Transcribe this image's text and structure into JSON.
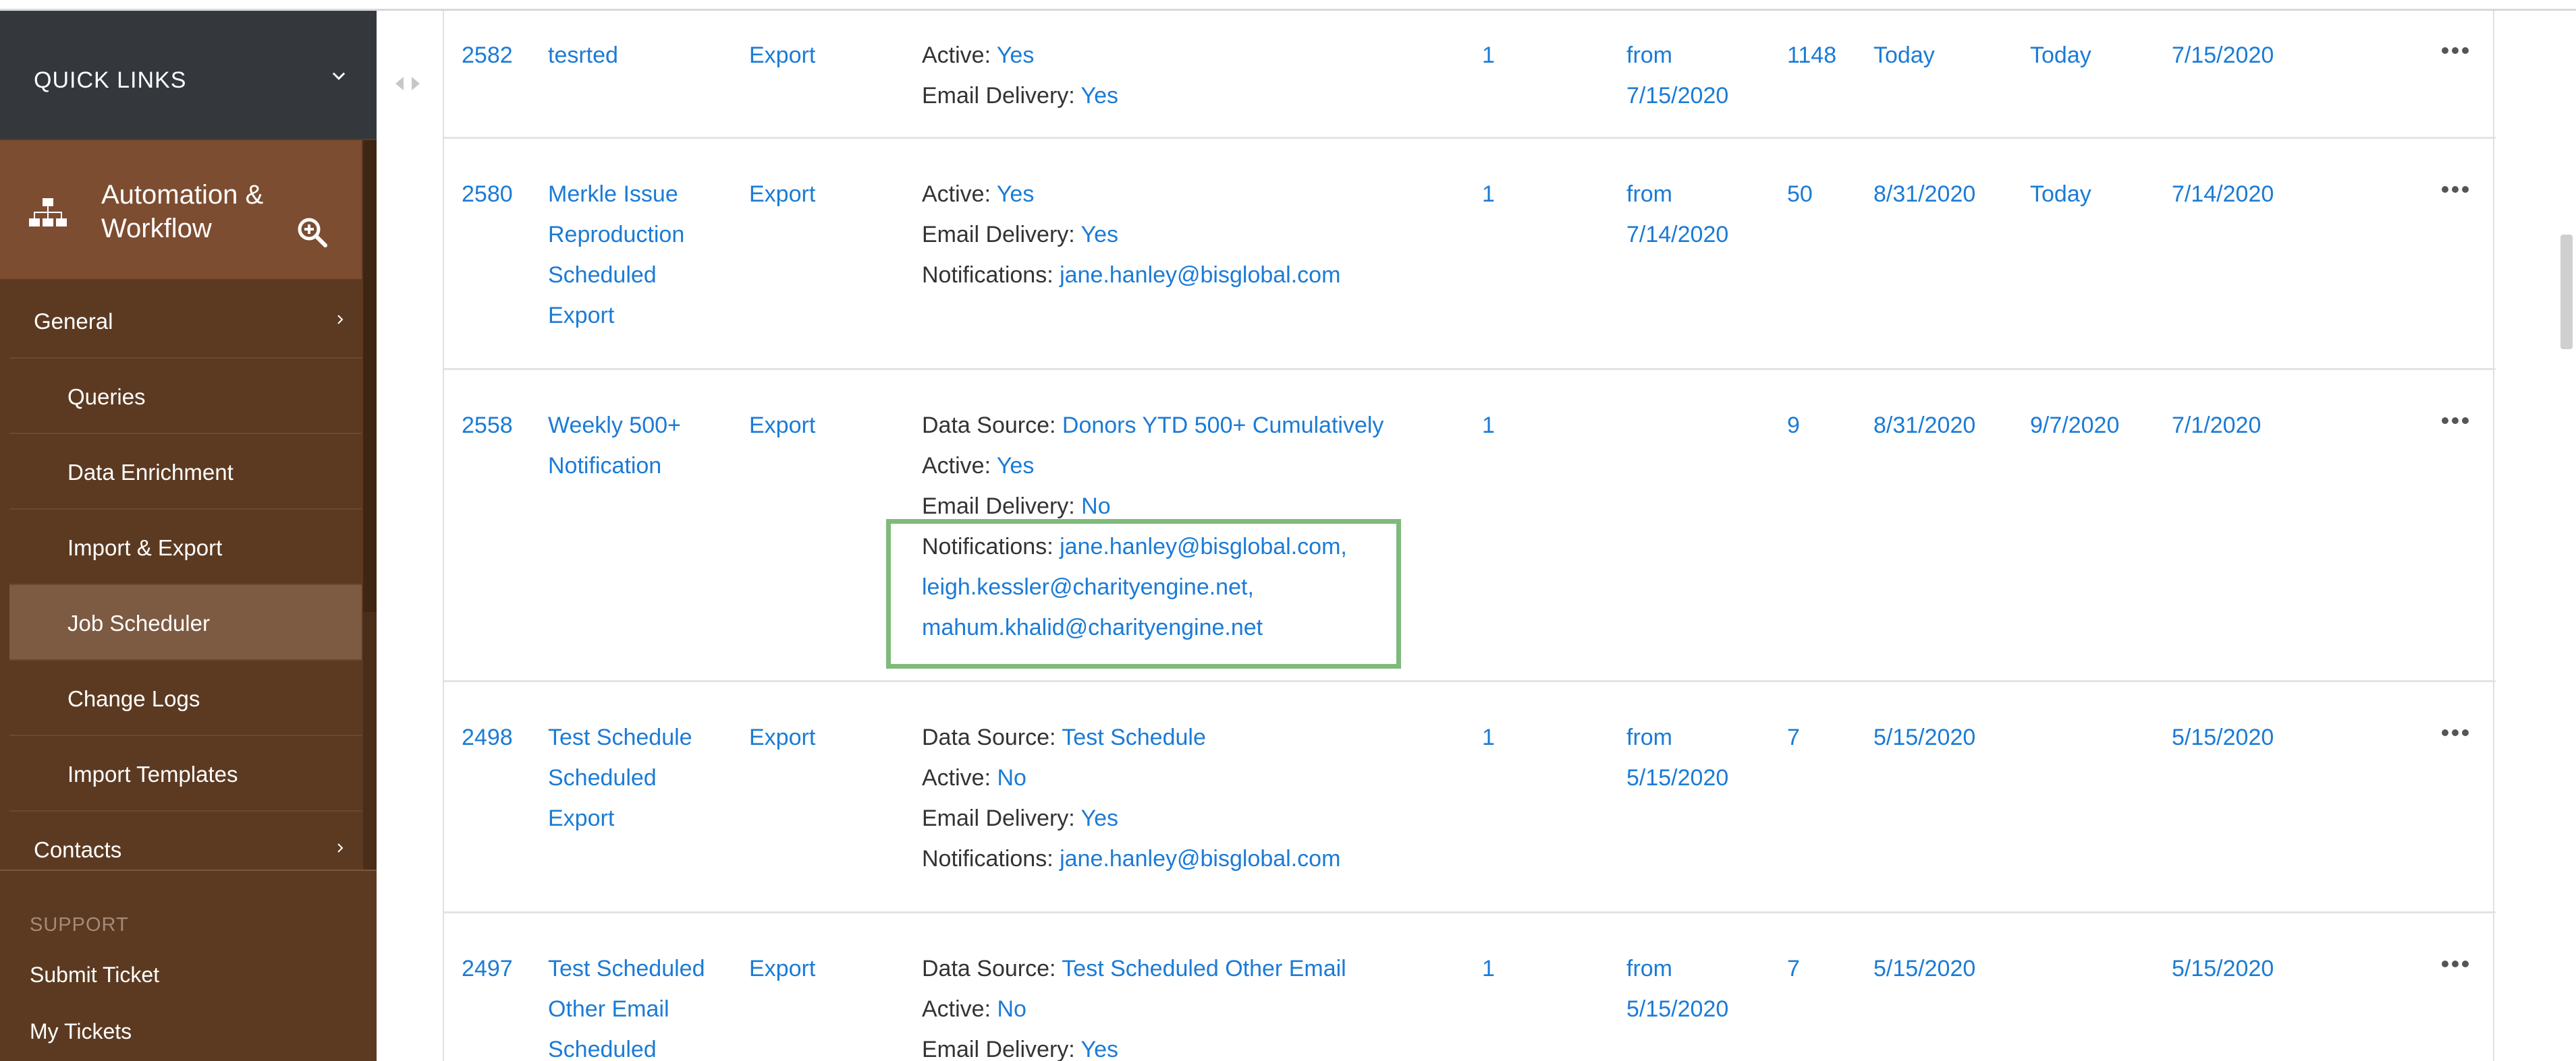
{
  "sidebar": {
    "quick_links_label": "QUICK LINKS",
    "module_title": "Automation & Workflow",
    "nav": [
      {
        "label": "General",
        "kind": "group",
        "has_chevron": true
      },
      {
        "label": "Queries",
        "kind": "sub"
      },
      {
        "label": "Data Enrichment",
        "kind": "sub"
      },
      {
        "label": "Import & Export",
        "kind": "sub"
      },
      {
        "label": "Job Scheduler",
        "kind": "sub",
        "active": true
      },
      {
        "label": "Change Logs",
        "kind": "sub"
      },
      {
        "label": "Import Templates",
        "kind": "sub"
      },
      {
        "label": "Contacts",
        "kind": "group",
        "has_chevron": true
      }
    ],
    "support_heading": "SUPPORT",
    "support_links": [
      "Submit Ticket",
      "My Tickets"
    ]
  },
  "icons": {
    "quick_links_chevron": "chevron-down-icon",
    "module_icon": "sitemap-icon",
    "module_search": "zoom-in-icon",
    "nav_chevron": "chevron-right-icon",
    "splitter": "splitter-arrows-icon",
    "row_menu": "more-horizontal-icon"
  },
  "colors": {
    "sidebar_bg": "#5c3a21",
    "quick_links_bg": "#34383d",
    "module_bg": "#7d4d31",
    "active_nav_bg": "#7d5a42",
    "link_blue": "#1b7bd6",
    "highlight_green": "#7fba7a"
  },
  "jobs": [
    {
      "id": "2582",
      "name_lines": [
        "tesrted"
      ],
      "type": "Export",
      "details": [
        {
          "label": "Active: ",
          "value": "Yes"
        },
        {
          "label": "Email Delivery: ",
          "value": "Yes"
        }
      ],
      "count": "1",
      "from_lines": [
        "from",
        "7/15/2020"
      ],
      "records": "1148",
      "col_a": "Today",
      "col_b": "Today",
      "col_c": "7/15/2020"
    },
    {
      "id": "2580",
      "name_lines": [
        "Merkle Issue",
        "Reproduction",
        "Scheduled",
        "Export"
      ],
      "type": "Export",
      "details": [
        {
          "label": "Active: ",
          "value": "Yes"
        },
        {
          "label": "Email Delivery: ",
          "value": "Yes"
        },
        {
          "label": "Notifications: ",
          "value": "jane.hanley@bisglobal.com"
        }
      ],
      "count": "1",
      "from_lines": [
        "from",
        "7/14/2020"
      ],
      "records": "50",
      "col_a": "8/31/2020",
      "col_b": "Today",
      "col_c": "7/14/2020"
    },
    {
      "id": "2558",
      "name_lines": [
        "Weekly 500+",
        "Notification"
      ],
      "type": "Export",
      "details": [
        {
          "label": "Data Source: ",
          "value": "Donors YTD 500+ Cumulatively"
        },
        {
          "label": "Active: ",
          "value": "Yes"
        },
        {
          "label": "Email Delivery: ",
          "value": "No"
        },
        {
          "label": "Notifications: ",
          "value": "jane.hanley@bisglobal.com,"
        },
        {
          "label": "",
          "value": "leigh.kessler@charityengine.net,"
        },
        {
          "label": "",
          "value": "mahum.khalid@charityengine.net"
        }
      ],
      "count": "1",
      "from_lines": [],
      "records": "9",
      "col_a": "8/31/2020",
      "col_b": "9/7/2020",
      "col_c": "7/1/2020"
    },
    {
      "id": "2498",
      "name_lines": [
        "Test Schedule",
        "Scheduled",
        "Export"
      ],
      "type": "Export",
      "details": [
        {
          "label": "Data Source: ",
          "value": "Test Schedule"
        },
        {
          "label": "Active: ",
          "value": "No"
        },
        {
          "label": "Email Delivery: ",
          "value": "Yes"
        },
        {
          "label": "Notifications: ",
          "value": "jane.hanley@bisglobal.com"
        }
      ],
      "count": "1",
      "from_lines": [
        "from",
        "5/15/2020"
      ],
      "records": "7",
      "col_a": "5/15/2020",
      "col_b": "",
      "col_c": "5/15/2020"
    },
    {
      "id": "2497",
      "name_lines": [
        "Test Scheduled",
        "Other Email",
        "Scheduled"
      ],
      "type": "Export",
      "details": [
        {
          "label": "Data Source: ",
          "value": "Test Scheduled Other Email"
        },
        {
          "label": "Active: ",
          "value": "No"
        },
        {
          "label": "Email Delivery: ",
          "value": "Yes"
        }
      ],
      "count": "1",
      "from_lines": [
        "from",
        "5/15/2020"
      ],
      "records": "7",
      "col_a": "5/15/2020",
      "col_b": "",
      "col_c": "5/15/2020"
    }
  ]
}
